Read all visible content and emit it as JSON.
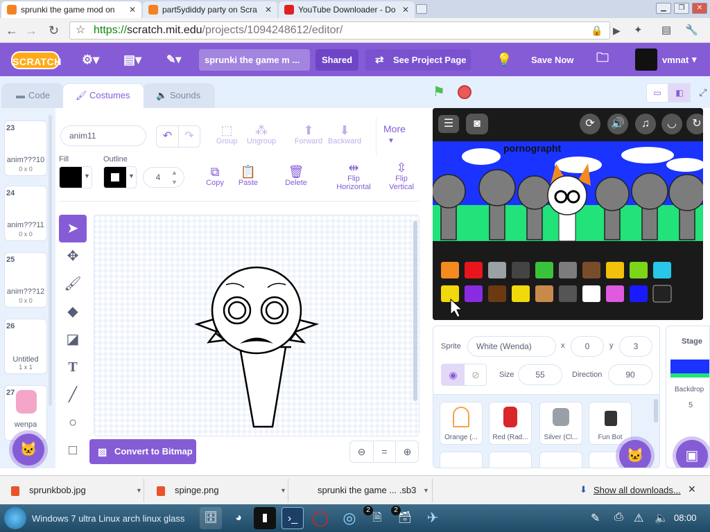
{
  "browser": {
    "tabs": [
      {
        "title": "sprunki the game mod on",
        "fav_color": "#f58220",
        "active": true
      },
      {
        "title": "part5ydiddy party on Scra",
        "fav_color": "#f58220",
        "active": false
      },
      {
        "title": "YouTube Downloader - Do",
        "fav_color": "#e02020",
        "active": false
      }
    ],
    "url_scheme": "https://",
    "url_host": "scratch.mit.edu",
    "url_path": "/projects/1094248612/editor/"
  },
  "menu": {
    "logo": "SCRATCH",
    "project_title": "sprunki the game m ...",
    "shared": "Shared",
    "see_project": "See Project Page",
    "save_now": "Save Now",
    "username": "vmnat"
  },
  "editor_tabs": {
    "code": "Code",
    "costumes": "Costumes",
    "sounds": "Sounds"
  },
  "costumes": [
    {
      "num": "23",
      "name": "anim???10",
      "size": "0 x 0"
    },
    {
      "num": "24",
      "name": "anim???11",
      "size": "0 x 0"
    },
    {
      "num": "25",
      "name": "anim???12",
      "size": "0 x 0"
    },
    {
      "num": "26",
      "name": "Untitled",
      "size": "1 x 1"
    },
    {
      "num": "27",
      "name": "wenpa",
      "size": ""
    }
  ],
  "paint": {
    "costume_name": "anim11",
    "fill_label": "Fill",
    "outline_label": "Outline",
    "outline_width": "4",
    "group": "Group",
    "ungroup": "Ungroup",
    "forward": "Forward",
    "backward": "Backward",
    "more": "More",
    "copy": "Copy",
    "paste": "Paste",
    "delete": "Delete",
    "flip_h_1": "Flip",
    "flip_h_2": "Horizontal",
    "flip_v_1": "Flip",
    "flip_v_2": "Vertical",
    "convert": "Convert to Bitmap",
    "zoom_reset": "="
  },
  "stage": {
    "overlay_text": "pornographt"
  },
  "sprite_info": {
    "sprite_label": "Sprite",
    "sprite_name": "White (Wenda)",
    "x_label": "x",
    "x": "0",
    "y_label": "y",
    "y": "3",
    "size_label": "Size",
    "size": "55",
    "direction_label": "Direction",
    "direction": "90"
  },
  "sprites": [
    {
      "name": "Orange (...",
      "color": "#f7a14b"
    },
    {
      "name": "Red (Rad...",
      "color": "#d9262a"
    },
    {
      "name": "Silver (Cl...",
      "color": "#9aa0a6"
    },
    {
      "name": "Fun Bot",
      "color": "#333333"
    }
  ],
  "stage_panel": {
    "label": "Stage",
    "backdrops_label": "Backdrop",
    "backdrops_count": "5"
  },
  "downloads": {
    "items": [
      "sprunkbob.jpg",
      "spinge.png",
      "sprunki the game ... .sb3"
    ],
    "show_all": "Show all downloads..."
  },
  "taskbar": {
    "start_text": "Windows 7 ultra Linux arch linux glass",
    "badge1": "2",
    "badge2": "2",
    "clock": "08:00"
  },
  "colors": {
    "scratch_purple": "#855cd6",
    "logo_orange": "#ffab19",
    "stage_blue": "#1a33ff",
    "stage_green": "#22e27a"
  }
}
